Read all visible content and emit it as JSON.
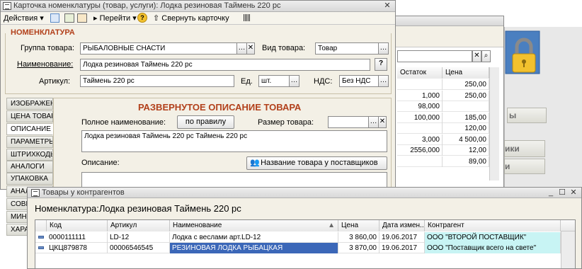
{
  "card_window": {
    "title": "Карточка номенклатуры (товар, услуги): Лодка резиновая Таймень 220 рс",
    "toolbar": {
      "actions": "Действия",
      "goto": "Перейти",
      "collapse": "Свернуть карточку"
    },
    "section_title": "НОМЕНКЛАТУРА",
    "group_label": "Группа товара:",
    "group_value": "РЫБАЛОВНЫЕ СНАСТИ",
    "kind_label": "Вид товара:",
    "kind_value": "Товар",
    "name_label": "Наименование:",
    "name_value": "Лодка резиновая Таймень 220 рс",
    "help_btn": "?",
    "article_label": "Артикул:",
    "article_value": "Таймень 220 рс",
    "unit_label": "Ед.",
    "unit_value": "шт.",
    "vat_label": "НДС:",
    "vat_value": "Без НДС",
    "tabs": [
      "ИЗОБРАЖЕНИЕ",
      "ЦЕНА ТОВАРА",
      "ОПИСАНИЕ",
      "ПАРАМЕТРЫ",
      "ШТРИХКОДЫ",
      "АНАЛОГИ",
      "УПАКОВКА",
      "АНАЛ",
      "СОВМ",
      "МИН",
      "ХАРА"
    ],
    "desc_title": "РАЗВЕРНУТОЕ ОПИСАНИЕ ТОВАРА",
    "full_name_label": "Полное наименование:",
    "rule_btn": "по правилу",
    "size_label": "Размер товара:",
    "full_name_value": "Лодка резиновая Таймень 220 рс Таймень 220 рс",
    "description_label": "Описание:",
    "supplier_name_btn": "Название товара у поставщиков"
  },
  "bg_window": {
    "col_stock": "Остаток",
    "col_price": "Цена",
    "rows": [
      {
        "stock": "",
        "price": "250,00"
      },
      {
        "stock": "1,000",
        "price": "250,00"
      },
      {
        "stock": "98,000",
        "price": ""
      },
      {
        "stock": "100,000",
        "price": "185,00"
      },
      {
        "stock": "",
        "price": "120,00"
      },
      {
        "stock": "3,000",
        "price": "4 500,00"
      },
      {
        "stock": "2556,000",
        "price": "12,00"
      },
      {
        "stock": "",
        "price": "89,00"
      }
    ],
    "right_btn_1": "ы",
    "right_btn_2": "ики",
    "right_btn_3": "и"
  },
  "goods_window": {
    "title": "Товары у контрагентов",
    "header": "Номенклатура:Лодка резиновая Таймень 220 рс",
    "columns": [
      "Код",
      "Артикул",
      "Наименование",
      "Цена",
      "Дата измен...",
      "Контрагент"
    ],
    "rows": [
      {
        "code": "0000111111",
        "article": "LD-12",
        "name": "Лодка с веслами арт.LD-12",
        "price": "3 860,00",
        "date": "19.06.2017",
        "partner": "ООО \"ВТОРОЙ ПОСТАВЩИК\""
      },
      {
        "code": "ЦКЦ879878",
        "article": "00006546545",
        "name": "РЕЗИНОВАЯ ЛОДКА РЫБАЦКАЯ",
        "price": "3 870,00",
        "date": "19.06.2017",
        "partner": "ООО \"Поставщик всего на свете\""
      }
    ]
  },
  "colors": {
    "accent_red": "#b2401b",
    "selected_row": "#3b67b8",
    "partner_highlight": "#c8f4f4",
    "logo_yellow": "#f2c12e"
  }
}
